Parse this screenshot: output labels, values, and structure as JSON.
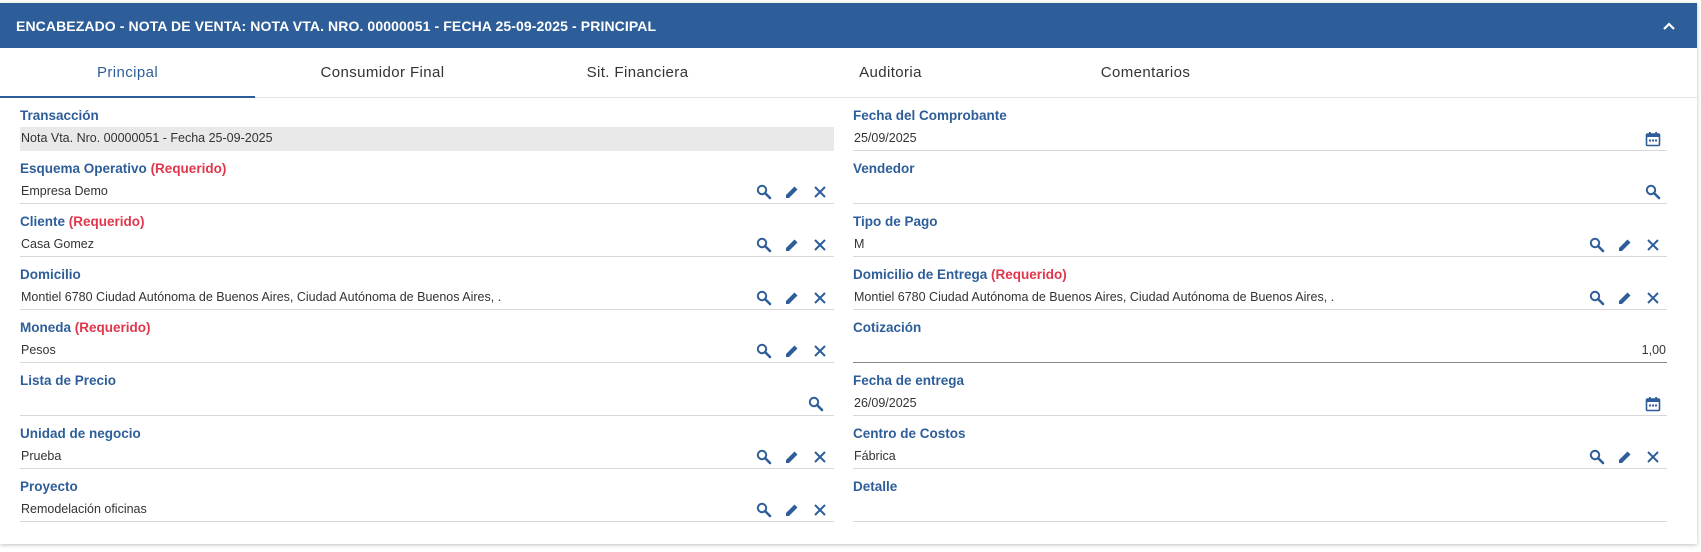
{
  "header": {
    "title": "ENCABEZADO - NOTA DE VENTA: NOTA VTA. NRO. 00000051 - FECHA 25-09-2025 - PRINCIPAL",
    "collapse_icon": "chevron-up-icon",
    "background": "#2e5e99"
  },
  "tabs": [
    {
      "label": "Principal",
      "active": true
    },
    {
      "label": "Consumidor Final"
    },
    {
      "label": "Sit. Financiera"
    },
    {
      "label": "Auditoria"
    },
    {
      "label": "Comentarios"
    }
  ],
  "required_text": "(Requerido)",
  "left": [
    {
      "label": "Transacción",
      "value": "Nota Vta. Nro.  00000051 - Fecha 25-09-2025"
    },
    {
      "label": "Esquema Operativo",
      "value": "Empresa Demo"
    },
    {
      "label": "Cliente",
      "value": "Casa Gomez"
    },
    {
      "label": "Domicilio",
      "value": "Montiel 6780  Ciudad Autónoma de Buenos Aires, Ciudad Autónoma de Buenos Aires, ."
    },
    {
      "label": "Moneda",
      "value": "Pesos"
    },
    {
      "label": "Lista de Precio",
      "value": ""
    },
    {
      "label": "Unidad de negocio",
      "value": "Prueba"
    },
    {
      "label": "Proyecto",
      "value": "Remodelación oficinas"
    }
  ],
  "right": [
    {
      "label": "Fecha del Comprobante",
      "value": "25/09/2025"
    },
    {
      "label": "Vendedor",
      "value": ""
    },
    {
      "label": "Tipo de Pago",
      "value": "M"
    },
    {
      "label": "Domicilio de Entrega",
      "value": "Montiel 6780  Ciudad Autónoma de Buenos Aires, Ciudad Autónoma de Buenos Aires, ."
    },
    {
      "label": "Cotización",
      "value": "1,00"
    },
    {
      "label": "Fecha de entrega",
      "value": "26/09/2025"
    },
    {
      "label": "Centro de Costos",
      "value": "Fábrica"
    },
    {
      "label": "Detalle",
      "value": ""
    }
  ],
  "colors": {
    "accent": "#2e5e99",
    "required": "#e0374c",
    "readonly_bg": "#e9e9e9"
  }
}
